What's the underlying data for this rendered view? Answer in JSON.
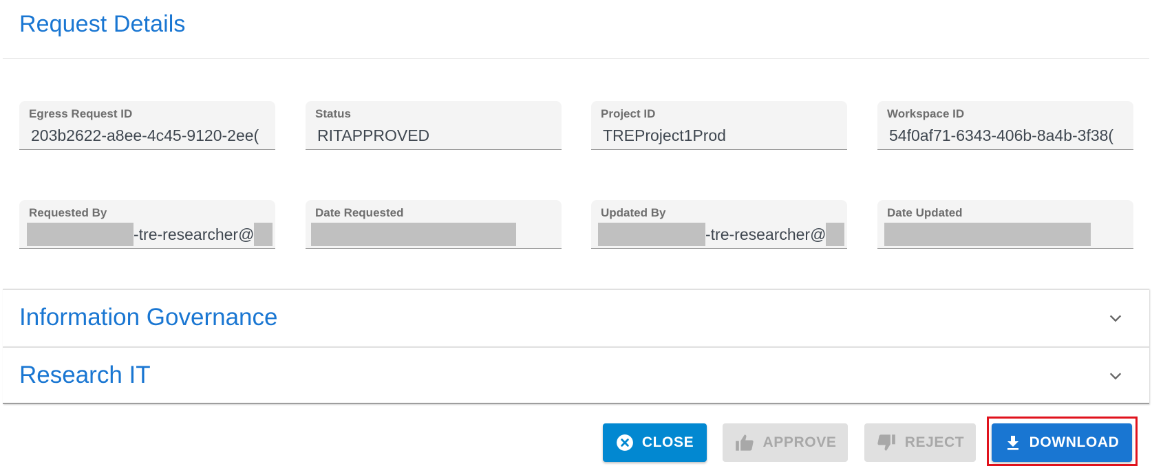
{
  "header": {
    "title": "Request Details"
  },
  "fields": [
    {
      "label": "Egress Request ID",
      "value": "203b2622-a8ee-4c45-9120-2ee("
    },
    {
      "label": "Status",
      "value": "RITAPPROVED"
    },
    {
      "label": "Project ID",
      "value": "TREProject1Prod"
    },
    {
      "label": "Workspace ID",
      "value": "54f0af71-6343-406b-8a4b-3f38("
    },
    {
      "label": "Requested By",
      "value": "-tre-researcher@",
      "redacted": true
    },
    {
      "label": "Date Requested",
      "value": "",
      "redacted": true
    },
    {
      "label": "Updated By",
      "value": "-tre-researcher@",
      "redacted": true
    },
    {
      "label": "Date Updated",
      "value": "",
      "redacted": true
    }
  ],
  "accordions": [
    {
      "title": "Information Governance",
      "icon": "chevron-down-icon",
      "expanded": false
    },
    {
      "title": "Research IT",
      "icon": "chevron-down-icon",
      "expanded": false
    }
  ],
  "actions": {
    "close": {
      "label": "CLOSE",
      "icon": "close-circle-icon",
      "enabled": true
    },
    "approve": {
      "label": "APPROVE",
      "icon": "thumbs-up-icon",
      "enabled": false
    },
    "reject": {
      "label": "REJECT",
      "icon": "thumbs-down-icon",
      "enabled": false
    },
    "download": {
      "label": "DOWNLOAD",
      "icon": "download-icon",
      "enabled": true,
      "highlighted": true
    }
  },
  "colors": {
    "accent": "#1976d2",
    "close_button": "#0288d1",
    "disabled_button": "#e0e0e0",
    "highlight_border": "#e0121c"
  }
}
